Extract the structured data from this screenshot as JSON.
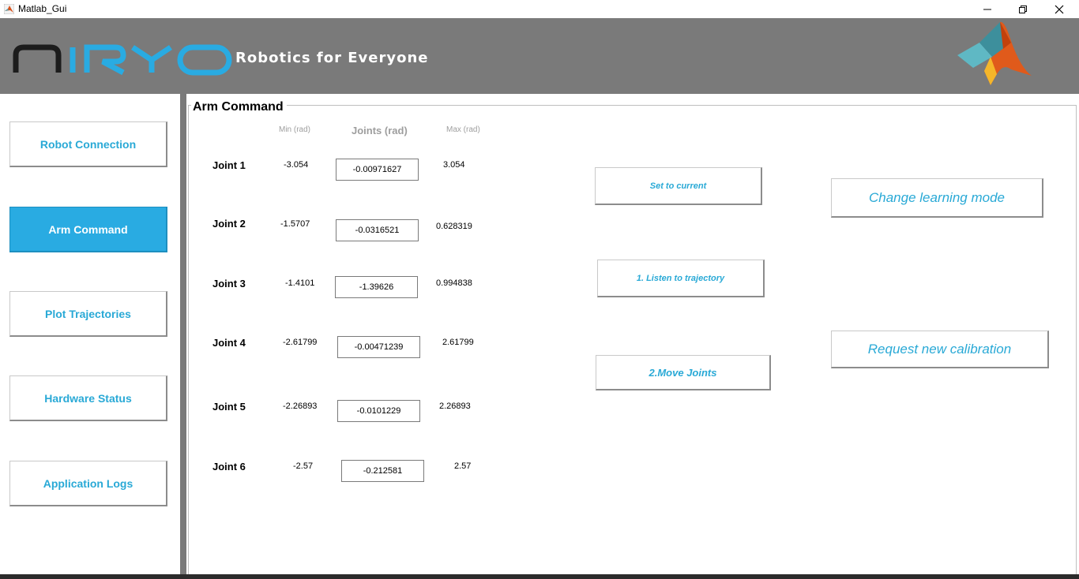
{
  "window": {
    "title": "Matlab_Gui"
  },
  "header": {
    "tagline": "Robotics for Everyone"
  },
  "sidebar": {
    "items": [
      {
        "label": "Robot Connection",
        "active": false
      },
      {
        "label": "Arm Command",
        "active": true
      },
      {
        "label": "Plot Trajectories",
        "active": false
      },
      {
        "label": "Hardware Status",
        "active": false
      },
      {
        "label": "Application Logs",
        "active": false
      }
    ]
  },
  "panel": {
    "title": "Arm Command",
    "headers": {
      "min": "Min (rad)",
      "joints": "Joints (rad)",
      "max": "Max (rad)"
    },
    "joints": [
      {
        "label": "Joint 1",
        "min": "-3.054",
        "value": "-0.00971627",
        "max": "3.054"
      },
      {
        "label": "Joint 2",
        "min": "-1.5707",
        "value": "-0.0316521",
        "max": "0.628319"
      },
      {
        "label": "Joint 3",
        "min": "-1.4101",
        "value": "-1.39626",
        "max": "0.994838"
      },
      {
        "label": "Joint 4",
        "min": "-2.61799",
        "value": "-0.00471239",
        "max": "2.61799"
      },
      {
        "label": "Joint 5",
        "min": "-2.26893",
        "value": "-0.0101229",
        "max": "2.26893"
      },
      {
        "label": "Joint 6",
        "min": "-2.57",
        "value": "-0.212581",
        "max": "2.57"
      }
    ],
    "buttons": {
      "set_current": "Set to current",
      "listen": "1. Listen to trajectory",
      "move": "2.Move Joints",
      "learning": "Change learning mode",
      "calibration": "Request new calibration"
    }
  },
  "colors": {
    "accent": "#29abe2",
    "header_bg": "#7a7a7a",
    "logo_blue": "#29abe2"
  },
  "icons": [
    "matlab-app-icon",
    "minimize-icon",
    "restore-icon",
    "close-icon",
    "niryo-logo",
    "matlab-logo"
  ]
}
